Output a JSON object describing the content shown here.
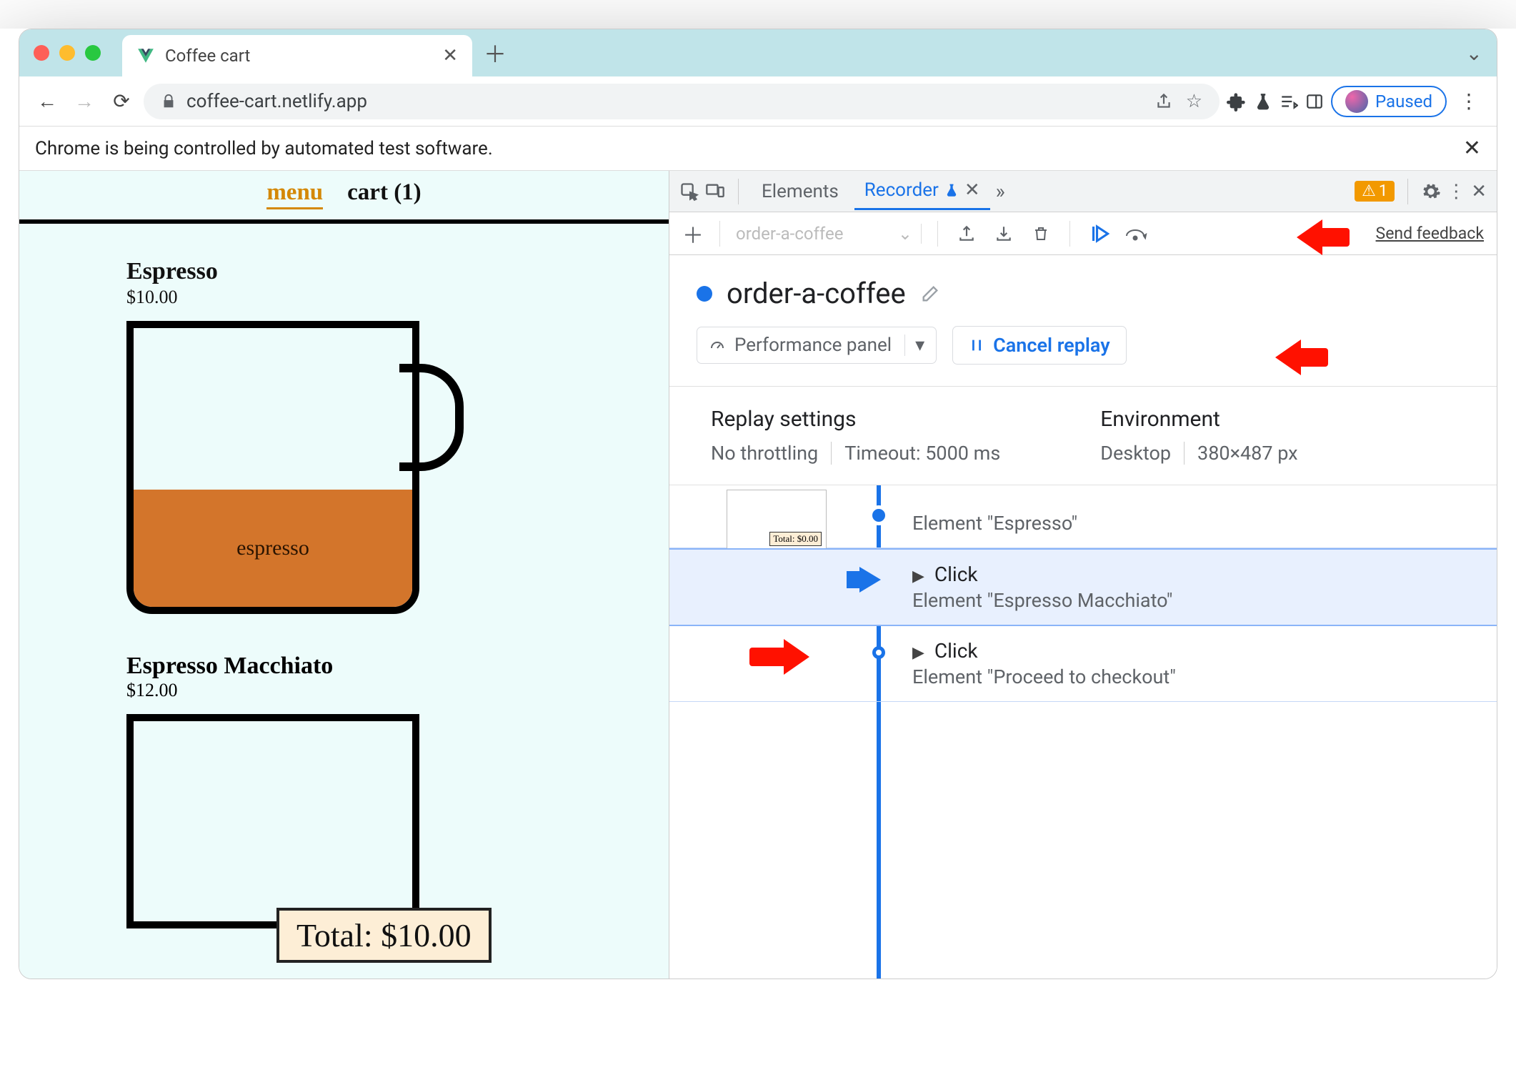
{
  "browser": {
    "tab_title": "Coffee cart",
    "url": "coffee-cart.netlify.app",
    "paused_label": "Paused",
    "automation_banner": "Chrome is being controlled by automated test software."
  },
  "page": {
    "nav": {
      "menu": "menu",
      "cart": "cart (1)"
    },
    "products": [
      {
        "name": "Espresso",
        "price": "$10.00",
        "fill_label": "espresso"
      },
      {
        "name": "Espresso Macchiato",
        "price": "$12.00"
      }
    ],
    "total_tooltip": "Total: $10.00"
  },
  "devtools": {
    "tabs": {
      "elements": "Elements",
      "recorder": "Recorder"
    },
    "issues_count": "1",
    "toolbar": {
      "recording_name_placeholder": "order-a-coffee",
      "feedback": "Send feedback"
    },
    "recording": {
      "name": "order-a-coffee",
      "perf_panel": "Performance panel",
      "cancel_replay": "Cancel replay"
    },
    "settings": {
      "replay_heading": "Replay settings",
      "throttle": "No throttling",
      "timeout": "Timeout: 5000 ms",
      "env_heading": "Environment",
      "device": "Desktop",
      "dimensions": "380×487 px"
    },
    "steps": [
      {
        "thumb_total": "Total: $0.00",
        "subtitle": "Element \"Espresso\""
      },
      {
        "title": "Click",
        "subtitle": "Element \"Espresso Macchiato\""
      },
      {
        "title": "Click",
        "subtitle": "Element \"Proceed to checkout\""
      }
    ]
  }
}
